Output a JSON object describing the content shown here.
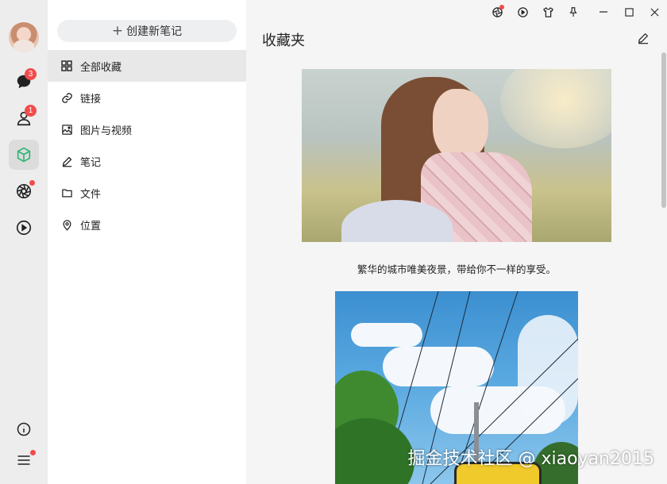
{
  "rail": {
    "messages_badge": "3",
    "contacts_badge": "1"
  },
  "panel": {
    "new_note_label": "创建新笔记",
    "categories": [
      {
        "label": "全部收藏",
        "icon": "grid-icon"
      },
      {
        "label": "链接",
        "icon": "link-icon"
      },
      {
        "label": "图片与视频",
        "icon": "image-icon"
      },
      {
        "label": "笔记",
        "icon": "pen-icon"
      },
      {
        "label": "文件",
        "icon": "folder-icon"
      },
      {
        "label": "位置",
        "icon": "location-pin-icon"
      }
    ]
  },
  "main": {
    "title": "收藏夹",
    "caption": "繁华的城市唯美夜景，带给你不一样的享受。",
    "watermark": "掘金技术社区 @ xiaoyan2015"
  },
  "colors": {
    "accent": "#2bb673",
    "badge": "#f24b4b",
    "rail_bg": "#ededed",
    "panel_bg": "#ffffff",
    "main_bg": "#f5f5f5"
  }
}
